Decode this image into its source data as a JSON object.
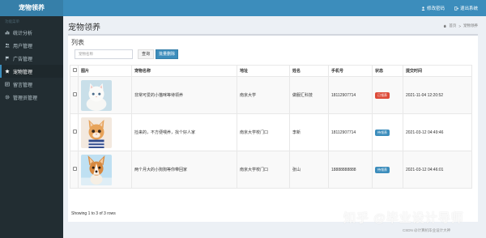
{
  "app": {
    "logo": "宠物领养"
  },
  "top_links": [
    {
      "label": "修改密码",
      "icon": "user-icon"
    },
    {
      "label": "退出系统",
      "icon": "logout-icon"
    }
  ],
  "sidebar": {
    "header": "功能菜单",
    "items": [
      {
        "label": "统计分析",
        "icon": "bar-chart-icon",
        "active": false
      },
      {
        "label": "用户管理",
        "icon": "users-icon",
        "active": false
      },
      {
        "label": "广告管理",
        "icon": "flag-icon",
        "active": false
      },
      {
        "label": "宠物管理",
        "icon": "star-icon",
        "active": true
      },
      {
        "label": "留言管理",
        "icon": "message-icon",
        "active": false
      },
      {
        "label": "管理员管理",
        "icon": "gear-icon",
        "active": false
      }
    ]
  },
  "page": {
    "title": "宠物领养",
    "breadcrumb": {
      "home": "首页",
      "current": "宠物领养"
    }
  },
  "list": {
    "title": "列表",
    "search_placeholder": "宠物名称",
    "query_label": "查询",
    "delete_label": "批量删除"
  },
  "table": {
    "columns": [
      "图片",
      "宠物名称",
      "地址",
      "姓名",
      "手机号",
      "状态",
      "提交时间"
    ],
    "rows": [
      {
        "pet": "white-kitten",
        "name": "非常可爱的小猫咪等待领养",
        "address": "南京大学",
        "person": "做服汇科技",
        "phone": "18112907714",
        "status": "已领养",
        "status_color": "#dd4b39",
        "time": "2021-11-04 12:20:52"
      },
      {
        "pet": "orange-kitten",
        "name": "捡来的，不方便喂养，找个好人家",
        "address": "南京大学校门口",
        "person": "李新",
        "phone": "18112907714",
        "status": "待领养",
        "status_color": "#3c8dbc",
        "time": "2021-03-12 04:49:46"
      },
      {
        "pet": "corgi-puppy",
        "name": "两个月大的小狗狗等你带回家",
        "address": "南京大学校门口",
        "person": "张山",
        "phone": "18888888888",
        "status": "待领养",
        "status_color": "#3c8dbc",
        "time": "2021-03-12 04:46:01"
      }
    ]
  },
  "footer": {
    "info": "Showing 1 to 3 of 3 rows"
  },
  "watermark": {
    "main": "知乎 @毕业设计导师",
    "sub": "CSDN @计算机毕业设计大神"
  }
}
